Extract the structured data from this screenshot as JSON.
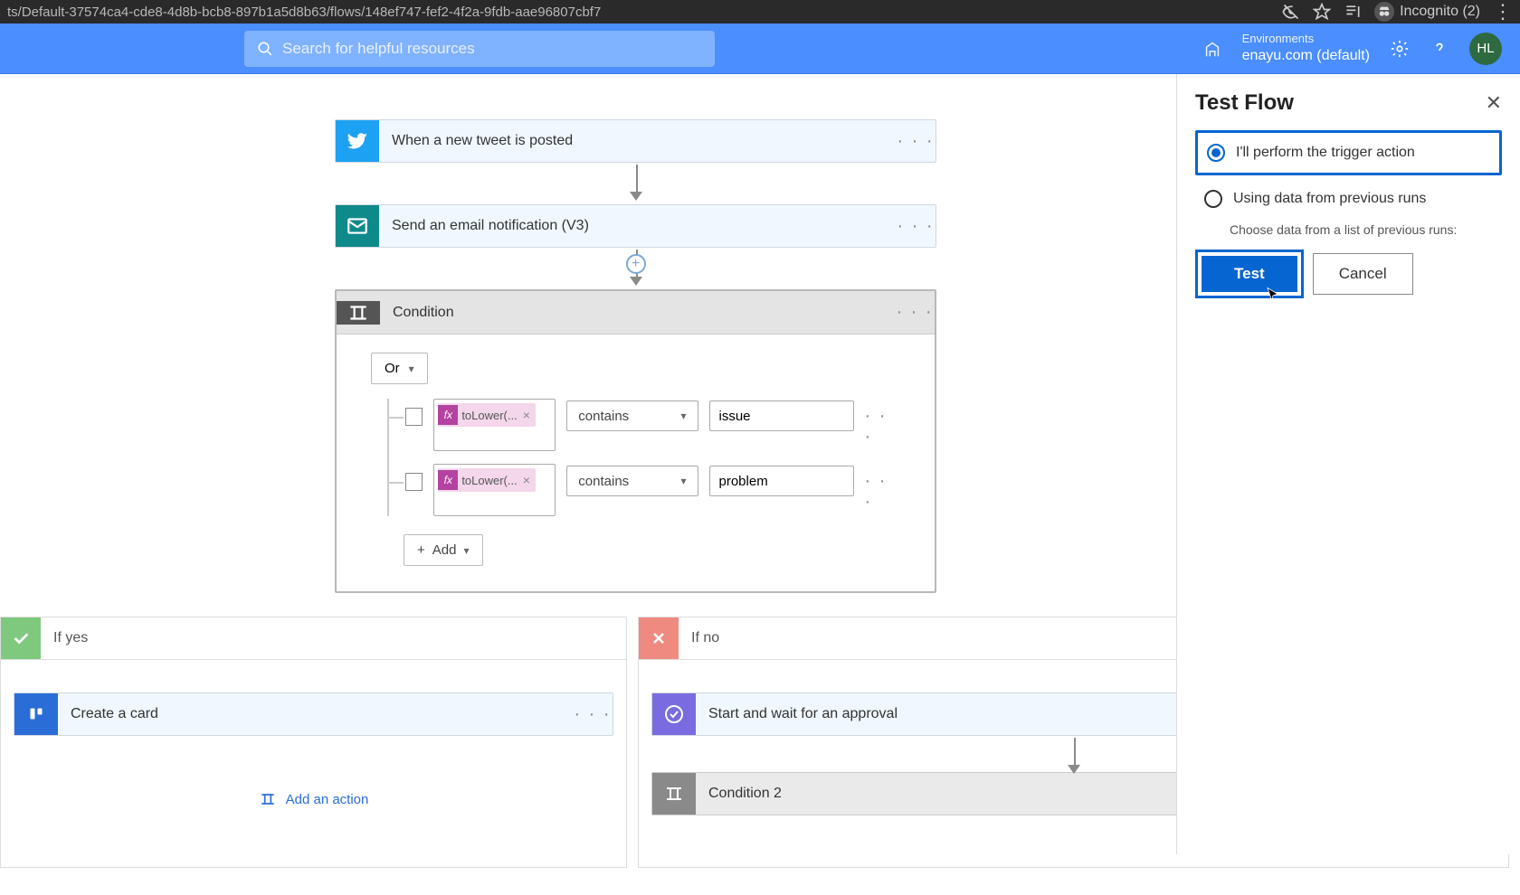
{
  "browser": {
    "url": "ts/Default-37574ca4-cde8-4d8b-bcb8-897b1a5d8b63/flows/148ef747-fef2-4f2a-9fdb-aae96807cbf7",
    "incognito_label": "Incognito (2)"
  },
  "header": {
    "search_placeholder": "Search for helpful resources",
    "environments_label": "Environments",
    "environment_name": "enayu.com (default)",
    "avatar_initials": "HL"
  },
  "flow": {
    "trigger": {
      "title": "When a new tweet is posted"
    },
    "email": {
      "title": "Send an email notification (V3)"
    },
    "condition": {
      "title": "Condition",
      "group_op": "Or",
      "rows": [
        {
          "token": "toLower(...",
          "operator": "contains",
          "value": "issue"
        },
        {
          "token": "toLower(...",
          "operator": "contains",
          "value": "problem"
        }
      ],
      "add_label": "Add"
    },
    "branches": {
      "yes": {
        "label": "If yes",
        "card": "Create a card",
        "add_action": "Add an action"
      },
      "no": {
        "label": "If no",
        "approval": "Start and wait for an approval",
        "cond2": "Condition 2"
      }
    }
  },
  "panel": {
    "title": "Test Flow",
    "opt_trigger": "I'll perform the trigger action",
    "opt_previous": "Using data from previous runs",
    "previous_hint": "Choose data from a list of previous runs:",
    "test_btn": "Test",
    "cancel_btn": "Cancel"
  }
}
